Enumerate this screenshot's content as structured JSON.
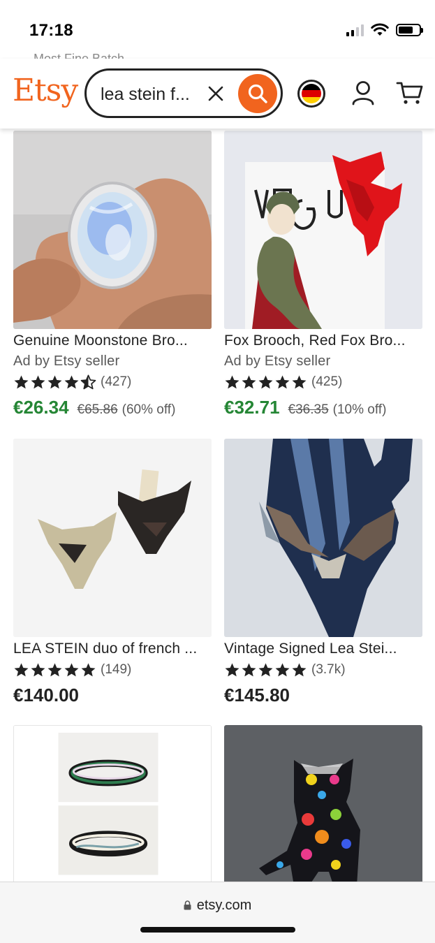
{
  "status_bar": {
    "time": "17:18"
  },
  "peek_text": "Most Fine Batch",
  "header": {
    "logo": "Etsy",
    "search_value": "lea stein f...",
    "colors": {
      "brand": "#F1641E"
    }
  },
  "listings": [
    {
      "title": "Genuine Moonstone Bro...",
      "ad_label": "Ad by Etsy seller",
      "stars": 4.5,
      "rating_count": "(427)",
      "price": "€26.34",
      "original_price": "€65.86",
      "discount": "(60% off)"
    },
    {
      "title": "Fox Brooch, Red Fox Bro...",
      "ad_label": "Ad by Etsy seller",
      "stars": 5,
      "rating_count": "(425)",
      "price": "€32.71",
      "original_price": "€36.35",
      "discount": "(10% off)"
    },
    {
      "title": "LEA STEIN duo of french ...",
      "stars": 5,
      "rating_count": "(149)",
      "price": "€140.00"
    },
    {
      "title": "Vintage Signed Lea Stei...",
      "stars": 5,
      "rating_count": "(3.7k)",
      "price": "€145.80"
    }
  ],
  "url_bar": {
    "url": "etsy.com"
  }
}
